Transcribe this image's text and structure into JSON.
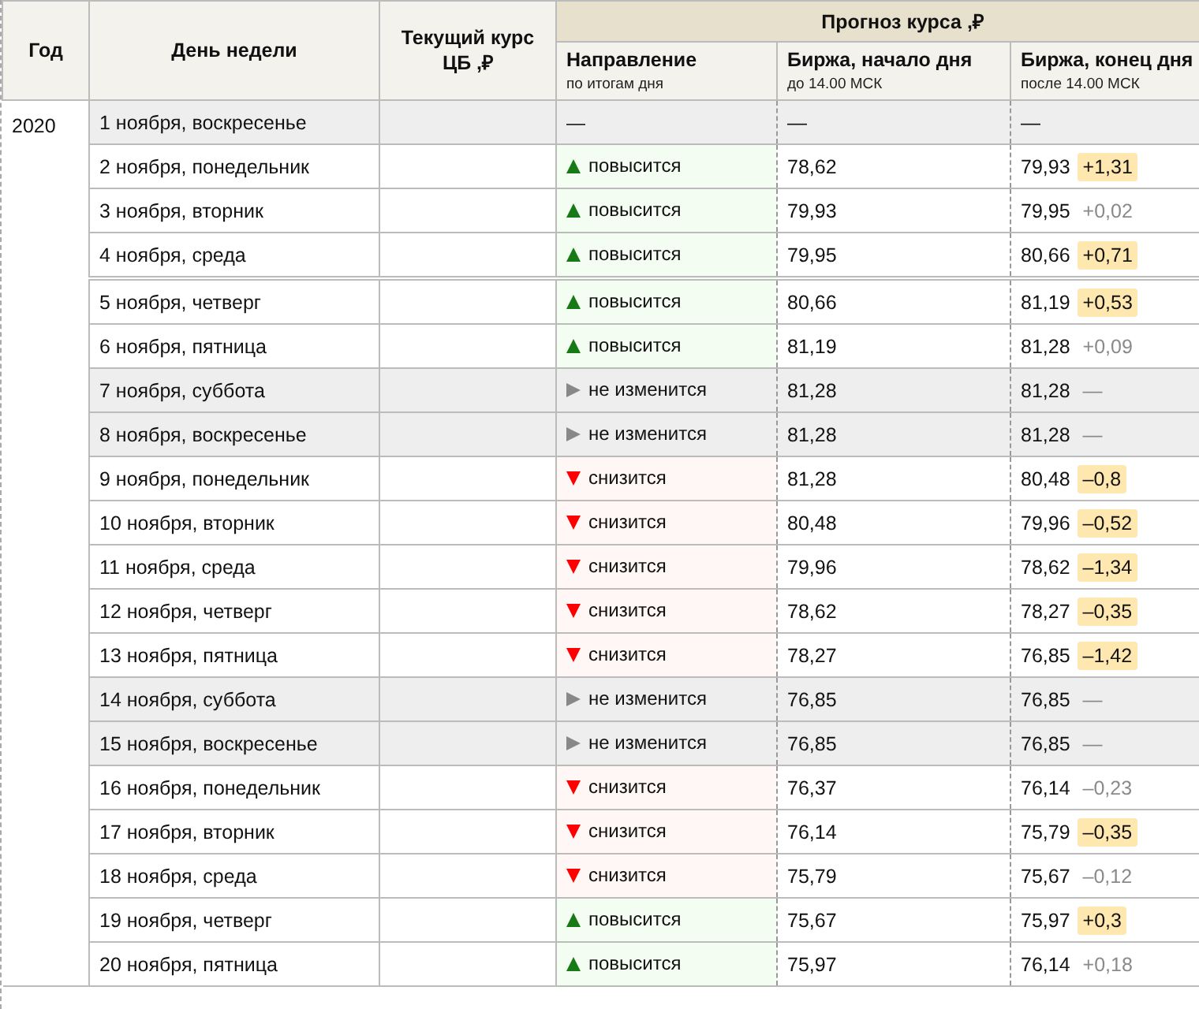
{
  "table": {
    "columns": [
      {
        "label": "Год"
      },
      {
        "label": "День недели"
      },
      {
        "label": "Текущий курс ЦБ ,₽"
      }
    ],
    "group": {
      "label": "Прогноз курса ,₽",
      "columns": [
        {
          "label": "Направление",
          "note": "по итогам дня"
        },
        {
          "label": "Биржа, начало дня",
          "note": "до 14.00 МСК"
        },
        {
          "label": "Биржа, конец дня",
          "note": "после 14.00 МСК"
        }
      ]
    },
    "year": "2020",
    "rows": [
      {
        "day": "1 ноября, воскресенье",
        "shaded": true,
        "separator_before": false,
        "direction": {
          "kind": "none",
          "label": "—"
        },
        "start": "—",
        "end": "—"
      },
      {
        "day": "2 ноября, понедельник",
        "shaded": false,
        "separator_before": false,
        "direction": {
          "kind": "up",
          "label": "повысится"
        },
        "start": "78,62",
        "end": "79,93",
        "change": {
          "text": "+1,31",
          "highlighted": true
        }
      },
      {
        "day": "3 ноября, вторник",
        "shaded": false,
        "separator_before": false,
        "direction": {
          "kind": "up",
          "label": "повысится"
        },
        "start": "79,93",
        "end": "79,95",
        "change": {
          "text": "+0,02",
          "highlighted": false
        }
      },
      {
        "day": "4 ноября, среда",
        "shaded": false,
        "separator_before": false,
        "direction": {
          "kind": "up",
          "label": "повысится"
        },
        "start": "79,95",
        "end": "80,66",
        "change": {
          "text": "+0,71",
          "highlighted": true
        }
      },
      {
        "day": "5 ноября, четверг",
        "shaded": false,
        "separator_before": true,
        "direction": {
          "kind": "up",
          "label": "повысится"
        },
        "start": "80,66",
        "end": "81,19",
        "change": {
          "text": "+0,53",
          "highlighted": true
        }
      },
      {
        "day": "6 ноября, пятница",
        "shaded": false,
        "separator_before": false,
        "direction": {
          "kind": "up",
          "label": "повысится"
        },
        "start": "81,19",
        "end": "81,28",
        "change": {
          "text": "+0,09",
          "highlighted": false
        }
      },
      {
        "day": "7 ноября, суббота",
        "shaded": true,
        "separator_before": false,
        "direction": {
          "kind": "same",
          "label": "не изменится"
        },
        "start": "81,28",
        "end": "81,28",
        "change": {
          "text": "—",
          "highlighted": false
        }
      },
      {
        "day": "8 ноября, воскресенье",
        "shaded": true,
        "separator_before": false,
        "direction": {
          "kind": "same",
          "label": "не изменится"
        },
        "start": "81,28",
        "end": "81,28",
        "change": {
          "text": "—",
          "highlighted": false
        }
      },
      {
        "day": "9 ноября, понедельник",
        "shaded": false,
        "separator_before": false,
        "direction": {
          "kind": "down",
          "label": "снизится"
        },
        "start": "81,28",
        "end": "80,48",
        "change": {
          "text": "–0,8",
          "highlighted": true
        }
      },
      {
        "day": "10 ноября, вторник",
        "shaded": false,
        "separator_before": false,
        "direction": {
          "kind": "down",
          "label": "снизится"
        },
        "start": "80,48",
        "end": "79,96",
        "change": {
          "text": "–0,52",
          "highlighted": true
        }
      },
      {
        "day": "11 ноября, среда",
        "shaded": false,
        "separator_before": false,
        "direction": {
          "kind": "down",
          "label": "снизится"
        },
        "start": "79,96",
        "end": "78,62",
        "change": {
          "text": "–1,34",
          "highlighted": true
        }
      },
      {
        "day": "12 ноября, четверг",
        "shaded": false,
        "separator_before": false,
        "direction": {
          "kind": "down",
          "label": "снизится"
        },
        "start": "78,62",
        "end": "78,27",
        "change": {
          "text": "–0,35",
          "highlighted": true
        }
      },
      {
        "day": "13 ноября, пятница",
        "shaded": false,
        "separator_before": false,
        "direction": {
          "kind": "down",
          "label": "снизится"
        },
        "start": "78,27",
        "end": "76,85",
        "change": {
          "text": "–1,42",
          "highlighted": true
        }
      },
      {
        "day": "14 ноября, суббота",
        "shaded": true,
        "separator_before": false,
        "direction": {
          "kind": "same",
          "label": "не изменится"
        },
        "start": "76,85",
        "end": "76,85",
        "change": {
          "text": "—",
          "highlighted": false
        }
      },
      {
        "day": "15 ноября, воскресенье",
        "shaded": true,
        "separator_before": false,
        "direction": {
          "kind": "same",
          "label": "не изменится"
        },
        "start": "76,85",
        "end": "76,85",
        "change": {
          "text": "—",
          "highlighted": false
        }
      },
      {
        "day": "16 ноября, понедельник",
        "shaded": false,
        "separator_before": false,
        "direction": {
          "kind": "down",
          "label": "снизится"
        },
        "start": "76,37",
        "end": "76,14",
        "change": {
          "text": "–0,23",
          "highlighted": false
        }
      },
      {
        "day": "17 ноября, вторник",
        "shaded": false,
        "separator_before": false,
        "direction": {
          "kind": "down",
          "label": "снизится"
        },
        "start": "76,14",
        "end": "75,79",
        "change": {
          "text": "–0,35",
          "highlighted": true
        }
      },
      {
        "day": "18 ноября, среда",
        "shaded": false,
        "separator_before": false,
        "direction": {
          "kind": "down",
          "label": "снизится"
        },
        "start": "75,79",
        "end": "75,67",
        "change": {
          "text": "–0,12",
          "highlighted": false
        }
      },
      {
        "day": "19 ноября, четверг",
        "shaded": false,
        "separator_before": false,
        "direction": {
          "kind": "up",
          "label": "повысится"
        },
        "start": "75,67",
        "end": "75,97",
        "change": {
          "text": "+0,3",
          "highlighted": true
        }
      },
      {
        "day": "20 ноября, пятница",
        "shaded": false,
        "separator_before": false,
        "direction": {
          "kind": "up",
          "label": "повысится"
        },
        "start": "75,97",
        "end": "76,14",
        "change": {
          "text": "+0,18",
          "highlighted": false
        }
      }
    ]
  }
}
